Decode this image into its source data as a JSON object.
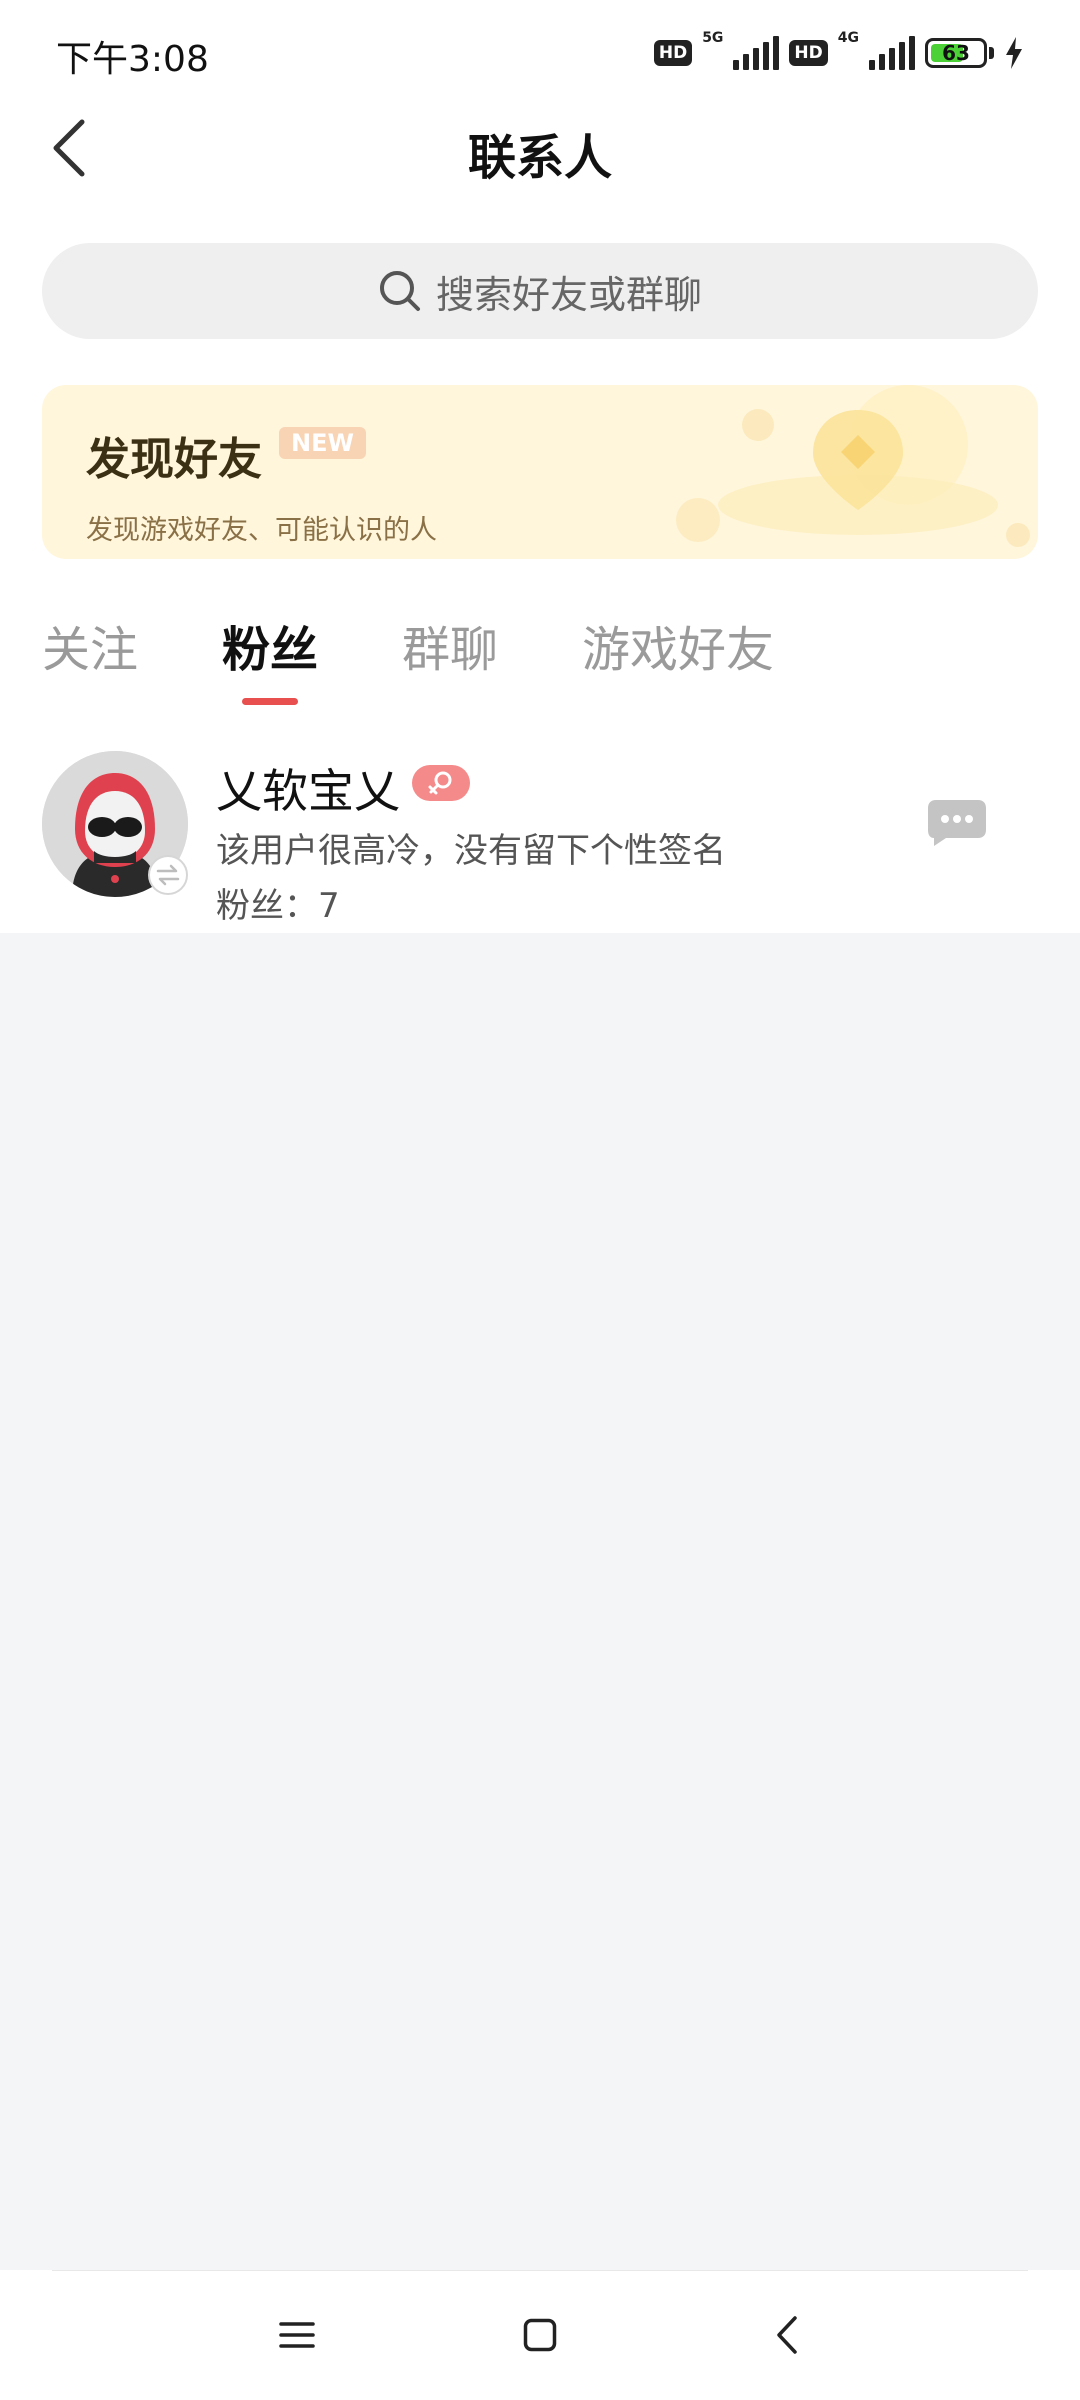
{
  "status_bar": {
    "time": "下午3:08",
    "hd_label": "HD",
    "net_1": "5G",
    "net_2": "4G",
    "battery": "63",
    "battery_level": 0.63,
    "battery_color": "#4cd137"
  },
  "header": {
    "title": "联系人",
    "back_icon": "chevron-left-icon"
  },
  "search": {
    "placeholder": "搜索好友或群聊",
    "icon": "search-icon"
  },
  "discover": {
    "title": "发现好友",
    "badge": "NEW",
    "subtitle": "发现游戏好友、可能认识的人"
  },
  "tabs": [
    {
      "label": "关注",
      "active": false
    },
    {
      "label": "粉丝",
      "active": true
    },
    {
      "label": "群聊",
      "active": false
    },
    {
      "label": "游戏好友",
      "active": false
    }
  ],
  "followers": [
    {
      "name": "乂软宝乂",
      "gender_icon": "female-icon",
      "bio": "该用户很高冷，没有留下个性签名",
      "fans": "粉丝：7"
    }
  ],
  "colors": {
    "accent": "#e85050",
    "banner_bg": "#fff6dc",
    "page_bg": "#f4f5f7"
  },
  "nav": {
    "menu_icon": "menu-icon",
    "home_icon": "home-square-icon",
    "back_icon": "back-chevron-icon"
  }
}
